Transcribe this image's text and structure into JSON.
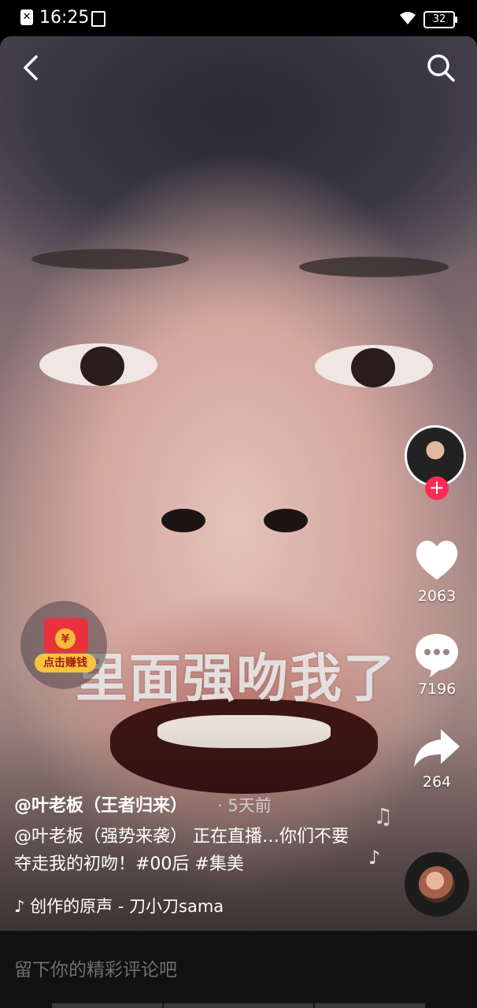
{
  "status_bar": {
    "time": "16:25",
    "battery": "32"
  },
  "video": {
    "subtitle": "里面强吻我了",
    "author": "@叶老板（王者归来）",
    "time_ago": "· 5天前",
    "description": "@叶老板（强势来袭） 正在直播…你们不要夺走我的初吻！#00后 #集美",
    "music": "创作的原声 - 刀小刀sama"
  },
  "actions": {
    "likes": "2063",
    "comments": "7196",
    "shares": "264"
  },
  "red_packet": {
    "label": "点击赚钱",
    "coin": "¥"
  },
  "comment_bar": {
    "placeholder": "留下你的精彩评论吧"
  },
  "icons": [
    "back-icon",
    "search-icon",
    "heart-icon",
    "comment-icon",
    "share-icon",
    "music-note-icon",
    "plus-icon",
    "wifi-icon",
    "battery-icon"
  ]
}
